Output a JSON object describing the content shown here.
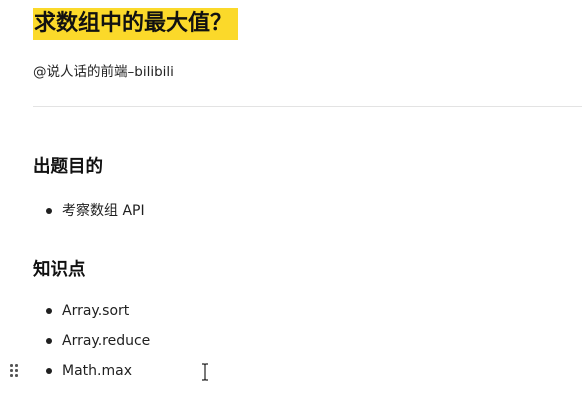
{
  "document": {
    "title": "求数组中的最大值？",
    "author_line": "@说人话的前端–bilibili"
  },
  "sections": [
    {
      "heading": "出题目的",
      "items": [
        "考察数组 API"
      ]
    },
    {
      "heading": "知识点",
      "items": [
        "Array.sort",
        "Array.reduce",
        "Math.max"
      ]
    }
  ],
  "icons": {
    "drag_handle": "drag-handle-icon",
    "cursor": "text-cursor-icon"
  },
  "colors": {
    "title_highlight": "#fbd92a",
    "text": "#1f1f1f",
    "divider": "#e3e3e3"
  }
}
